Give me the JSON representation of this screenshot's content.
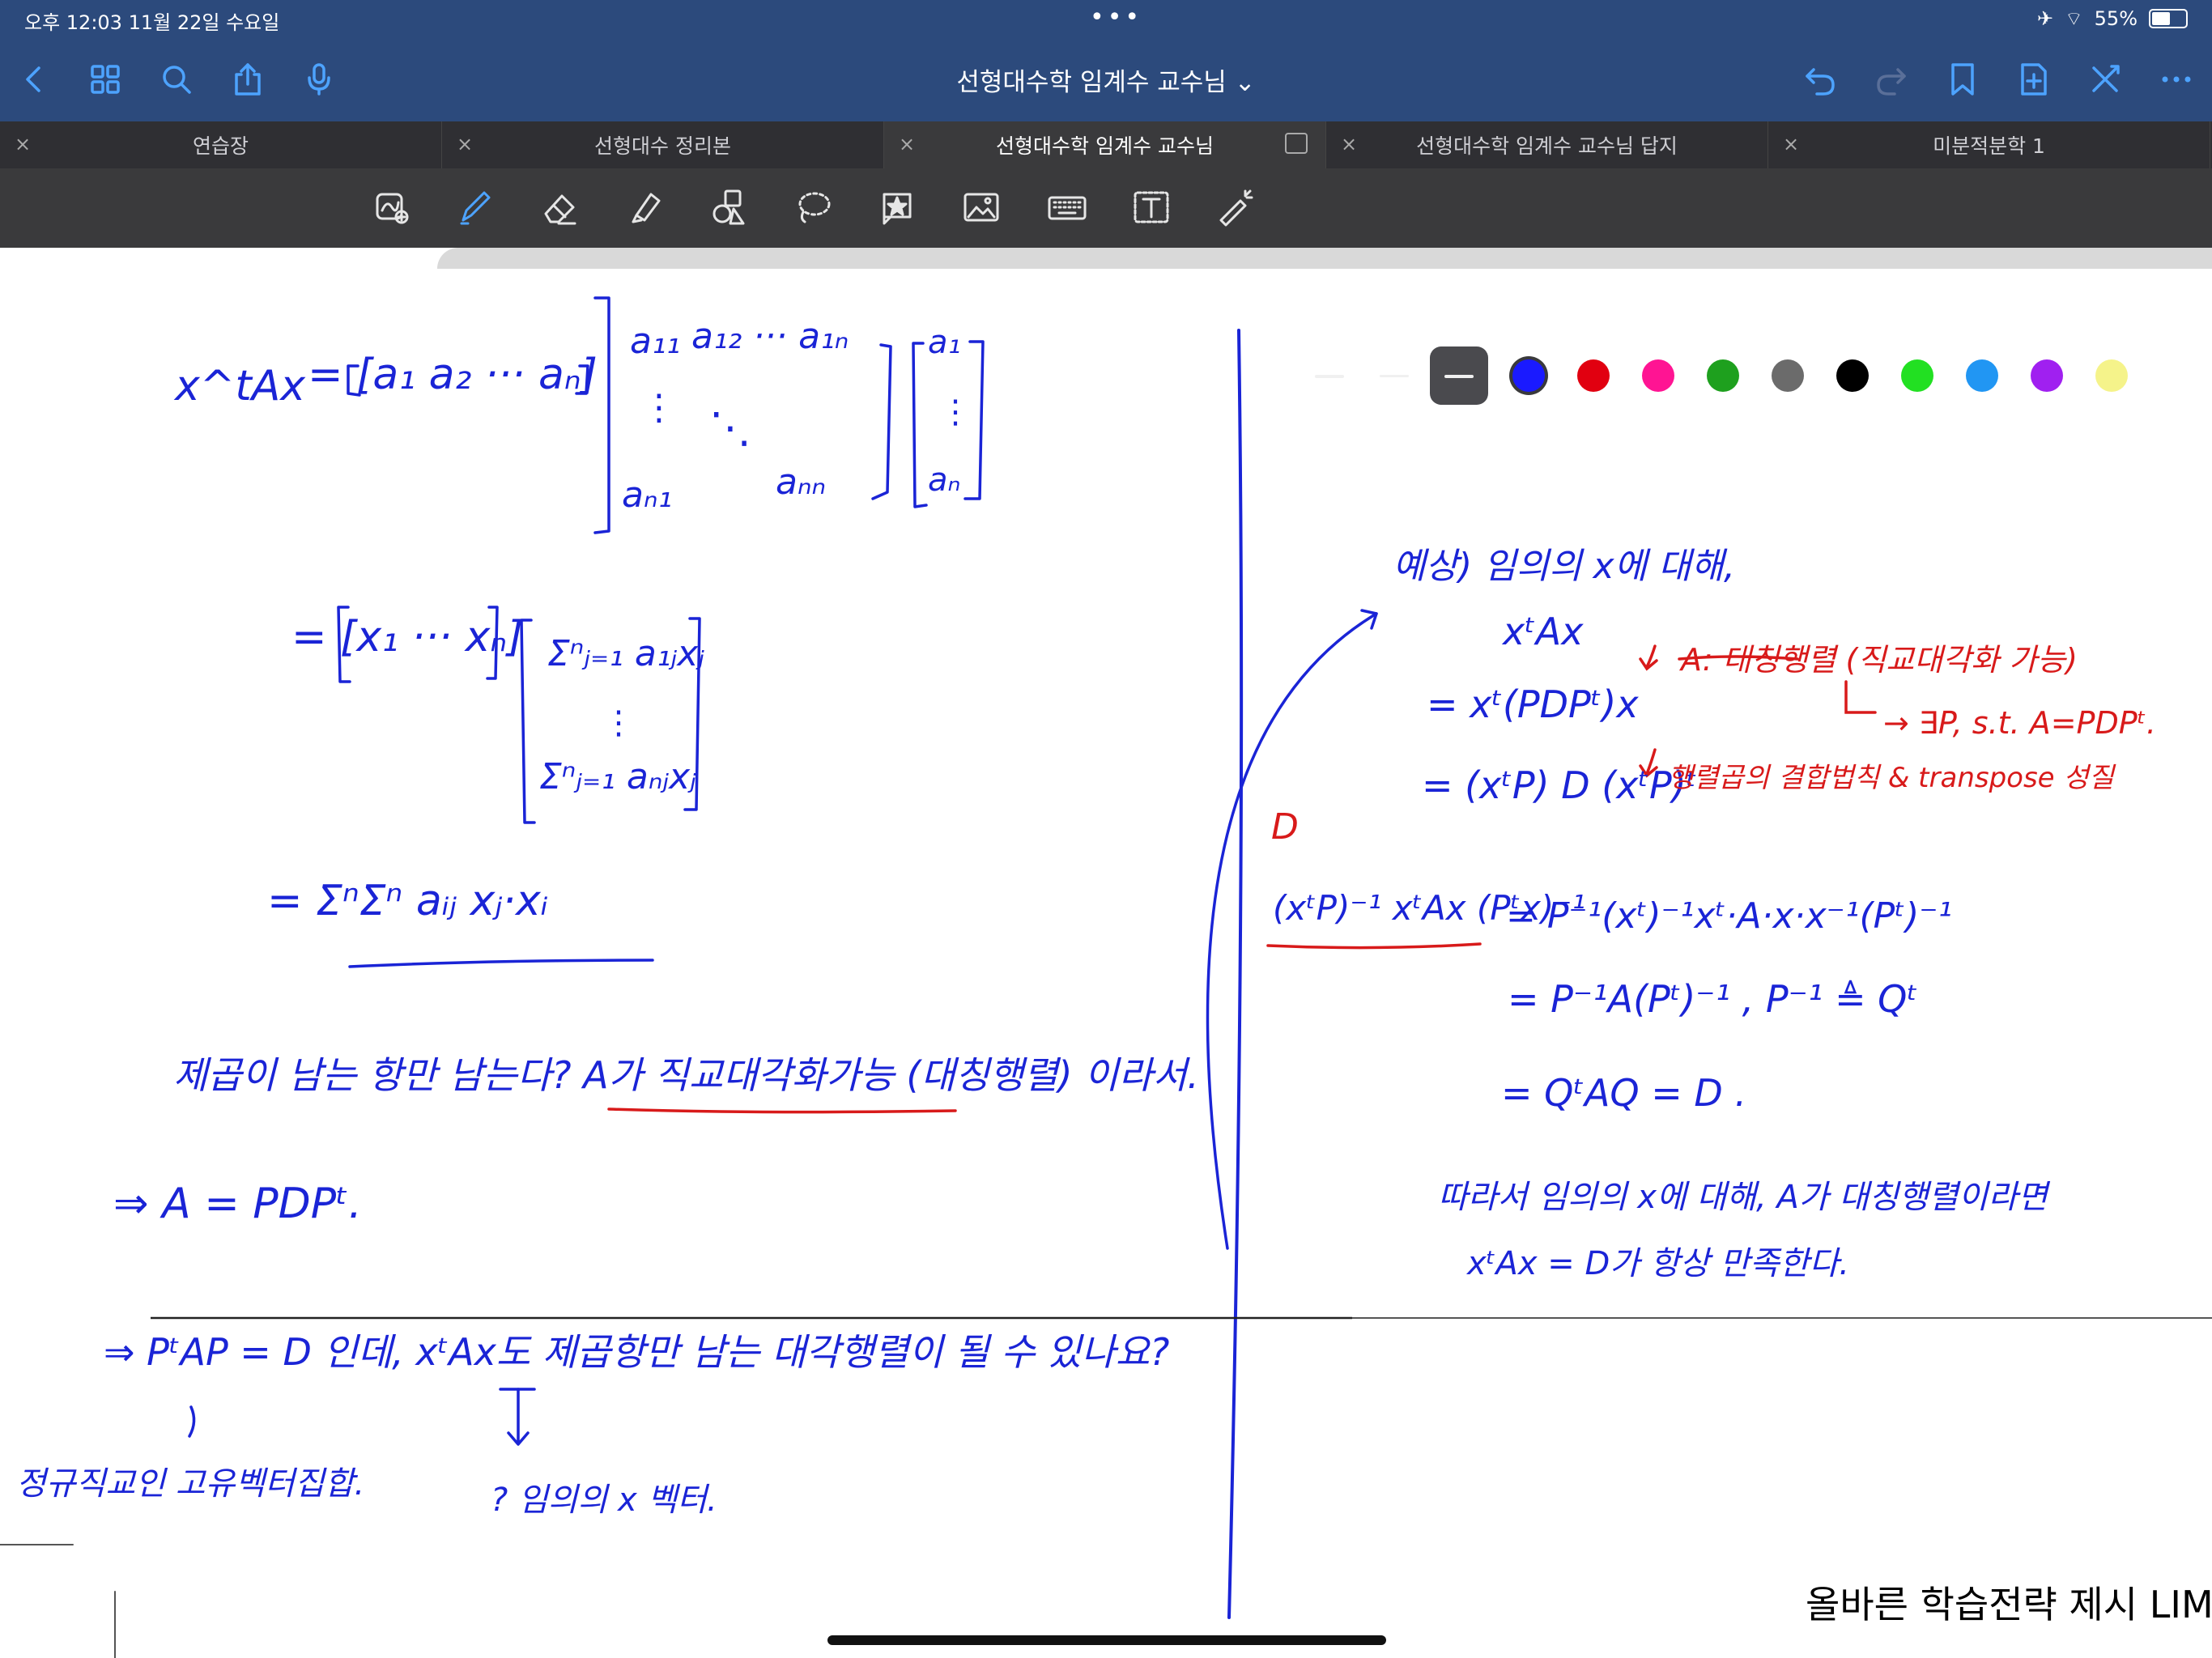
{
  "status_bar": {
    "time_date": "오후 12:03   11월 22일 수요일",
    "dots": "•••",
    "battery": "55%",
    "battery_level": 0.55
  },
  "nav": {
    "title": "선형대수학 임계수 교수님 ⌄"
  },
  "tabs": [
    {
      "label": "연습장",
      "active": false
    },
    {
      "label": "선형대수 정리본",
      "active": false
    },
    {
      "label": "선형대수학 임계수 교수님",
      "active": true
    },
    {
      "label": "선형대수학 임계수 교수님 답지",
      "active": false
    },
    {
      "label": "미분적분학 1",
      "active": false
    }
  ],
  "close_glyph": "×",
  "palette": [
    "#1a1aff",
    "#e10010",
    "#ff1493",
    "#1ea01e",
    "#6b6b6b",
    "#000000",
    "#22e022",
    "#2196f3",
    "#a020f0",
    "#f5f38a",
    "#ffffff"
  ],
  "ink": {
    "blue": "#1a24d6",
    "red": "#d81a1a"
  },
  "notes": {
    "eq1": "x^t A x = [a1 a2 ··· an] [a11 a12 ··· a1n ; ⋮ ⋱ ; an1 ann] [a1 ; ⋮ ; an]",
    "eq1_lhs": "x^tAx",
    "eq1_row": "= [a₁ a₂ ··· aₙ]",
    "m_a11": "a₁₁",
    "m_a12": "a₁₂ ··· a₁ₙ",
    "m_vdots": "⋮",
    "m_ddots": "⋱",
    "m_an1": "aₙ₁",
    "m_ann": "aₙₙ",
    "v_a1": "a₁",
    "v_an": "aₙ",
    "eq2_row": "= [x₁ ··· xₙ]",
    "eq2_top": "Σⁿⱼ₌₁ a₁ⱼxⱼ",
    "eq2_bot": "Σⁿⱼ₌₁ aₙⱼxⱼ",
    "eq3": "= ΣⁿΣⁿ aᵢⱼ xⱼ·xᵢ",
    "q_line": "제곱이 남는 항만 남는다?  A가 직교대각화가능 (대칭행렬) 이라서.",
    "arrow_line": "⇒   A = PDPᵗ.",
    "bottom_line": "⇒   PᵗAP = D  인데,   xᵗAx도 제곱항만 남는 대각행렬이 될 수 있나요?",
    "bottom_left": "정규직교인 고유벡터집합.",
    "bottom_mid": "? 임의의 x 벡터.",
    "r_heading": "예상) 임의의 x에 대해,",
    "r_xtax": "xᵗAx",
    "r_l2": "= xᵗ(PDPᵗ)x",
    "r_l3": "= (xᵗP) D (xᵗP)ᵗ",
    "r_note1": "A: 대칭행렬 (직교대각화 가능)",
    "r_note1b": "→ ∃P, s.t. A=PDPᵗ.",
    "r_note2": "행렬곱의 결합법칙 & transpose 성질",
    "r_D": "D",
    "r_l4_lhs": "(xᵗP)⁻¹ xᵗAx (Pᵗx)⁻¹",
    "r_l4_rhs": "= P⁻¹(xᵗ)⁻¹xᵗ·A·x·x⁻¹(Pᵗ)⁻¹",
    "r_l5": "= P⁻¹A(Pᵗ)⁻¹ ,   P⁻¹ ≜ Qᵗ",
    "r_l6": "= QᵗAQ = D .",
    "r_concl1": "따라서 임의의 x에 대해, A가 대칭행렬이라면",
    "r_concl2": "xᵗAx = D가 항상 만족한다.",
    "printed_text": "올바른 학습전략 제시 LIM"
  }
}
